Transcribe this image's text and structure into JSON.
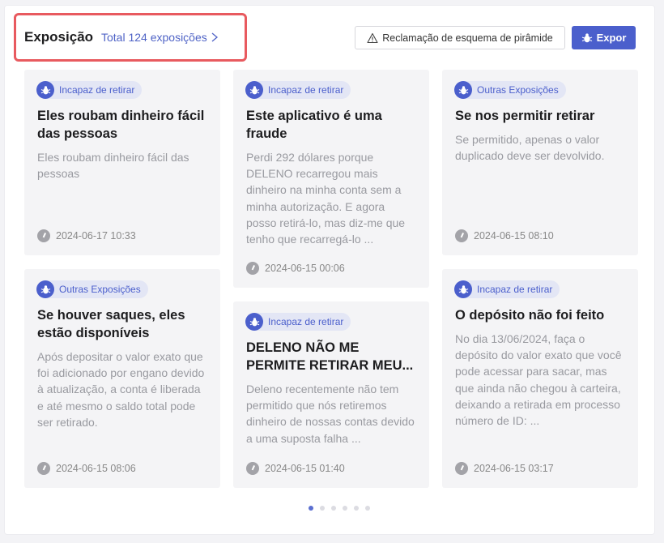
{
  "header": {
    "title": "Exposição",
    "total_link": "Total 124 exposições",
    "pyramid_button": "Reclamação de esquema de pirâmide",
    "expor_button": "Expor"
  },
  "colors": {
    "accent": "#4b5fcc",
    "badge_bg": "#e3e6f5",
    "highlight": "#e85a5f"
  },
  "cards": [
    {
      "tag": "Incapaz de retirar",
      "title": "Eles roubam dinheiro fácil das pessoas",
      "body": "Eles roubam dinheiro fácil das pessoas",
      "date": "2024-06-17 10:33"
    },
    {
      "tag": "Outras Exposições",
      "title": "Se houver saques, eles estão disponíveis",
      "body": "Após depositar o valor exato que foi adicionado por engano devido à atualização, a conta é liberada e até mesmo o saldo total pode ser retirado.",
      "date": "2024-06-15 08:06"
    },
    {
      "tag": "Incapaz de retirar",
      "title": "Este aplicativo é uma fraude",
      "body": "Perdi 292 dólares porque DELENO recarregou mais dinheiro na minha conta sem a minha autorização. E agora posso retirá-lo, mas diz-me que tenho que recarregá-lo ...",
      "date": "2024-06-15 00:06"
    },
    {
      "tag": "Incapaz de retirar",
      "title": "DELENO NÃO ME PERMITE RETIRAR MEU...",
      "body": "Deleno recentemente não tem permitido que nós retiremos dinheiro de nossas contas devido a uma suposta falha ...",
      "date": "2024-06-15 01:40"
    },
    {
      "tag": "Outras Exposições",
      "title": "Se nos permitir retirar",
      "body": "Se permitido, apenas o valor duplicado deve ser devolvido.",
      "date": "2024-06-15 08:10"
    },
    {
      "tag": "Incapaz de retirar",
      "title": "O depósito não foi feito",
      "body": "No dia 13/06/2024, faça o depósito do valor exato que você pode acessar para sacar, mas que ainda não chegou à carteira, deixando a retirada em processo número de ID: ...",
      "date": "2024-06-15 03:17"
    }
  ],
  "pagination": {
    "pages": 6,
    "active": 1
  }
}
